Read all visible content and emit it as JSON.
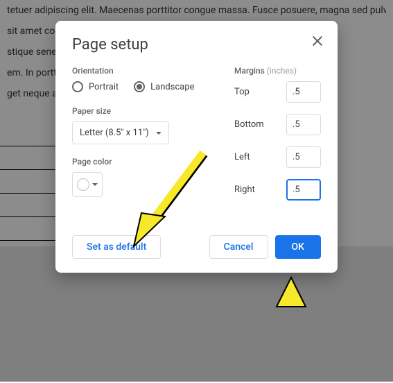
{
  "doc_lines": [
    "tetuer adipiscing elit. Maecenas porttitor congue massa. Fusce posuere, magna sed pulv",
    " sit amet commodo magna eros quis urna.                                                                    usce est. Viva",
    "stique senectus et netus et malesuada fames ac turpis e                                       etra nonumm",
    "em. In porttitor. Donec laoreet nonummy augue.                                                     elerisque at, v",
    "get neque at sem venenatis eleifend.",
    ""
  ],
  "dialog": {
    "title": "Page setup",
    "orientation": {
      "label": "Orientation",
      "portrait": "Portrait",
      "landscape": "Landscape",
      "selected": "landscape"
    },
    "paper_size": {
      "label": "Paper size",
      "value": "Letter (8.5\" x 11\")"
    },
    "page_color": {
      "label": "Page color",
      "value": "#ffffff"
    },
    "margins": {
      "label": "Margins",
      "unit": "(inches)",
      "top_label": "Top",
      "top": ".5",
      "bottom_label": "Bottom",
      "bottom": ".5",
      "left_label": "Left",
      "left": ".5",
      "right_label": "Right",
      "right": ".5"
    },
    "buttons": {
      "default": "Set as default",
      "cancel": "Cancel",
      "ok": "OK"
    }
  }
}
